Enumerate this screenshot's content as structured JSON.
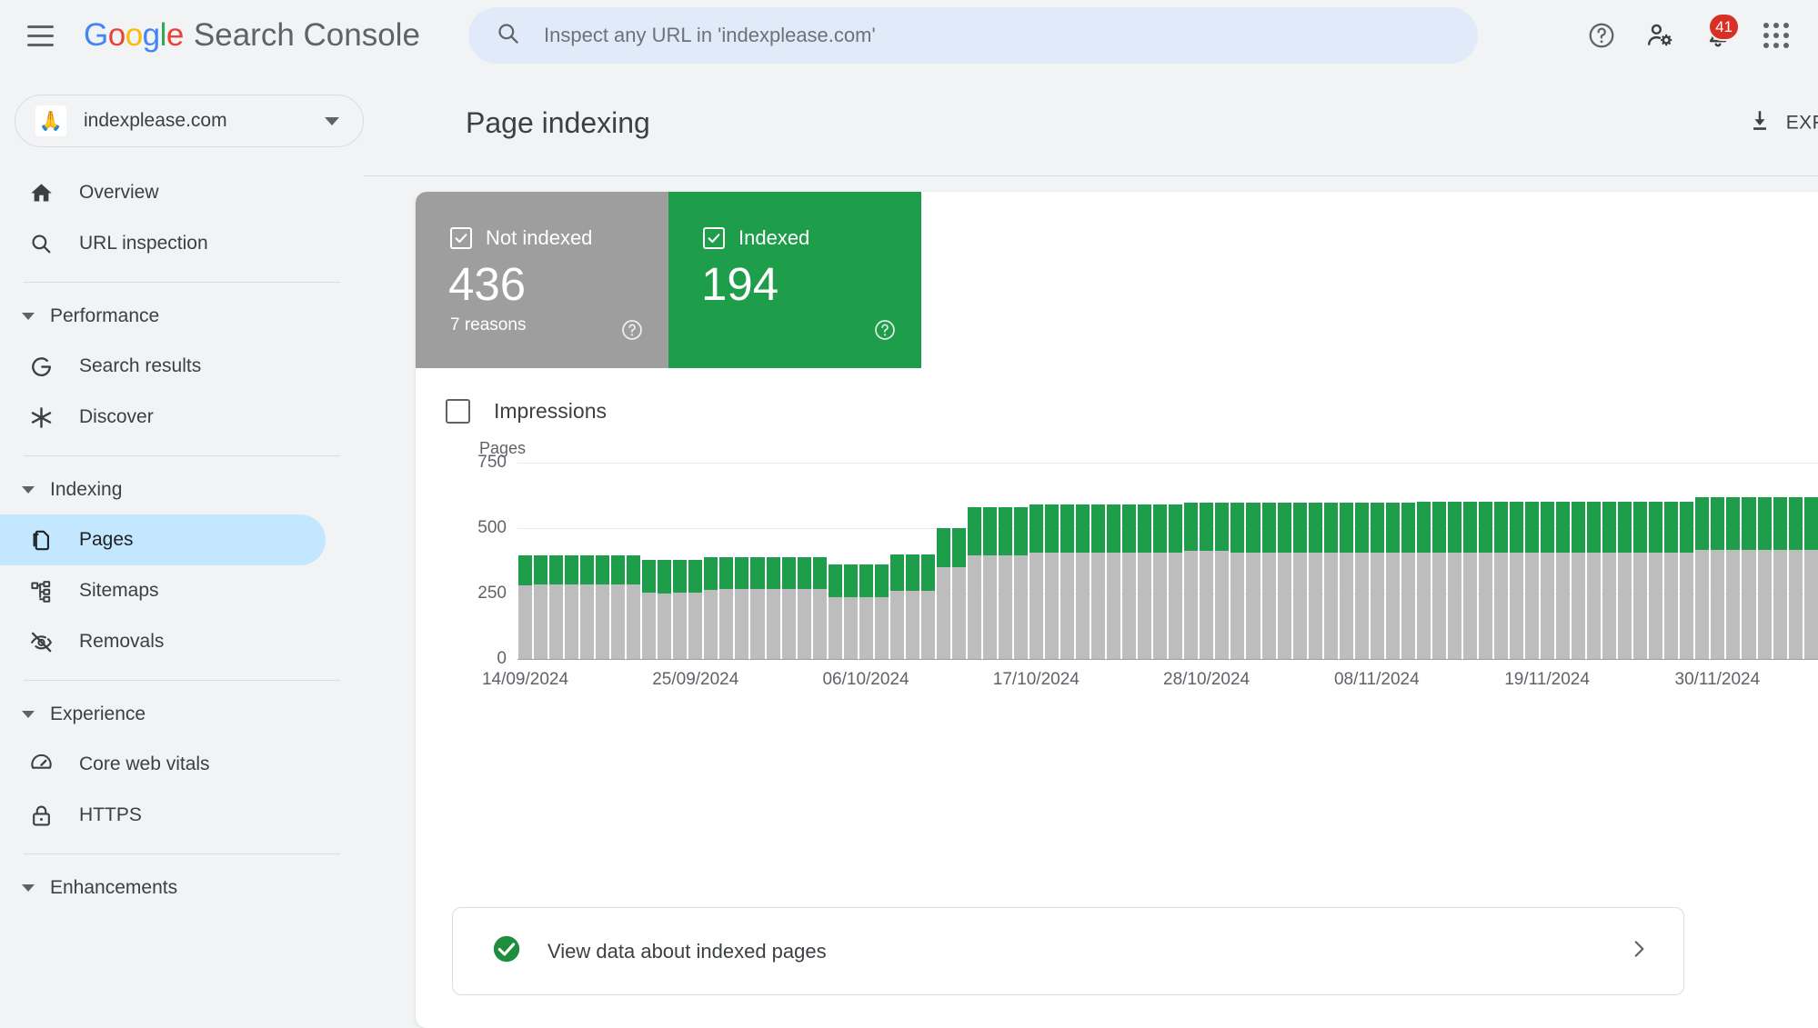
{
  "app": {
    "brand_google": "Google",
    "brand_product": "Search Console"
  },
  "search": {
    "placeholder": "Inspect any URL in 'indexplease.com'",
    "value": ""
  },
  "topbar": {
    "notifications_count": "41"
  },
  "sidebar": {
    "property": {
      "name": "indexplease.com",
      "favicon": "🙏"
    },
    "items": [
      {
        "label": "Overview",
        "icon": "home-icon",
        "type": "item",
        "active": false
      },
      {
        "label": "URL inspection",
        "icon": "search-icon",
        "type": "item",
        "active": false
      },
      {
        "label": "Performance",
        "icon": "chevron-down-icon",
        "type": "section"
      },
      {
        "label": "Search results",
        "icon": "google-g-icon",
        "type": "item",
        "active": false
      },
      {
        "label": "Discover",
        "icon": "asterisk-icon",
        "type": "item",
        "active": false
      },
      {
        "label": "Indexing",
        "icon": "chevron-down-icon",
        "type": "section"
      },
      {
        "label": "Pages",
        "icon": "pages-icon",
        "type": "item",
        "active": true
      },
      {
        "label": "Sitemaps",
        "icon": "sitemap-icon",
        "type": "item",
        "active": false
      },
      {
        "label": "Removals",
        "icon": "eye-off-icon",
        "type": "item",
        "active": false
      },
      {
        "label": "Experience",
        "icon": "chevron-down-icon",
        "type": "section"
      },
      {
        "label": "Core web vitals",
        "icon": "speedometer-icon",
        "type": "item",
        "active": false
      },
      {
        "label": "HTTPS",
        "icon": "lock-icon",
        "type": "item",
        "active": false
      },
      {
        "label": "Enhancements",
        "icon": "chevron-down-icon",
        "type": "section"
      }
    ]
  },
  "main": {
    "page_title": "Page indexing",
    "export_label": "EXP",
    "tiles": [
      {
        "label": "Not indexed",
        "value": "436",
        "sub": "7 reasons",
        "color": "#9e9e9e",
        "checked": true
      },
      {
        "label": "Indexed",
        "value": "194",
        "sub": "",
        "color": "#1e9e4a",
        "checked": true
      }
    ],
    "impressions": {
      "label": "Impressions",
      "checked": false
    },
    "view_data": {
      "label": "View data about indexed pages"
    }
  },
  "chart_data": {
    "type": "bar",
    "title": "",
    "stacked": true,
    "ylabel": "Pages",
    "xlabel": "",
    "ylim": [
      0,
      750
    ],
    "yticks": [
      0,
      250,
      500,
      750
    ],
    "ytick_labels": [
      "0",
      "250",
      "500",
      "750"
    ],
    "grid": true,
    "legend": [
      "Not indexed",
      "Indexed"
    ],
    "legend_position": "top-tiles",
    "colors": {
      "not_indexed": "#bdbdbd",
      "indexed": "#1e9e4a"
    },
    "x_tick_labels": [
      "14/09/2024",
      "25/09/2024",
      "06/10/2024",
      "17/10/2024",
      "28/10/2024",
      "08/11/2024",
      "19/11/2024",
      "30/11/2024"
    ],
    "x_tick_indices": [
      0,
      11,
      22,
      33,
      44,
      55,
      66,
      77
    ],
    "series": [
      {
        "name": "Not indexed",
        "values": [
          282,
          286,
          286,
          286,
          286,
          286,
          286,
          286,
          252,
          250,
          252,
          252,
          264,
          266,
          266,
          266,
          266,
          266,
          266,
          266,
          236,
          236,
          236,
          236,
          262,
          262,
          262,
          352,
          352,
          396,
          396,
          396,
          396,
          406,
          406,
          406,
          406,
          406,
          406,
          406,
          406,
          406,
          406,
          414,
          414,
          414,
          406,
          406,
          406,
          406,
          406,
          406,
          406,
          406,
          406,
          406,
          406,
          406,
          408,
          408,
          408,
          408,
          408,
          408,
          408,
          408,
          408,
          408,
          408,
          408,
          408,
          408,
          408,
          408,
          408,
          408,
          418,
          418,
          418,
          418,
          418,
          418,
          418,
          418
        ]
      },
      {
        "name": "Indexed",
        "values": [
          114,
          110,
          110,
          110,
          110,
          110,
          110,
          110,
          128,
          130,
          128,
          128,
          124,
          122,
          122,
          122,
          122,
          122,
          122,
          122,
          124,
          124,
          124,
          124,
          138,
          138,
          138,
          148,
          148,
          184,
          184,
          184,
          184,
          186,
          186,
          186,
          186,
          186,
          186,
          186,
          186,
          186,
          186,
          182,
          182,
          182,
          190,
          190,
          190,
          190,
          190,
          190,
          190,
          190,
          190,
          190,
          190,
          190,
          192,
          192,
          192,
          192,
          192,
          192,
          192,
          192,
          192,
          192,
          192,
          192,
          194,
          194,
          194,
          194,
          194,
          194,
          200,
          200,
          200,
          200,
          200,
          200,
          200,
          200
        ]
      }
    ]
  }
}
